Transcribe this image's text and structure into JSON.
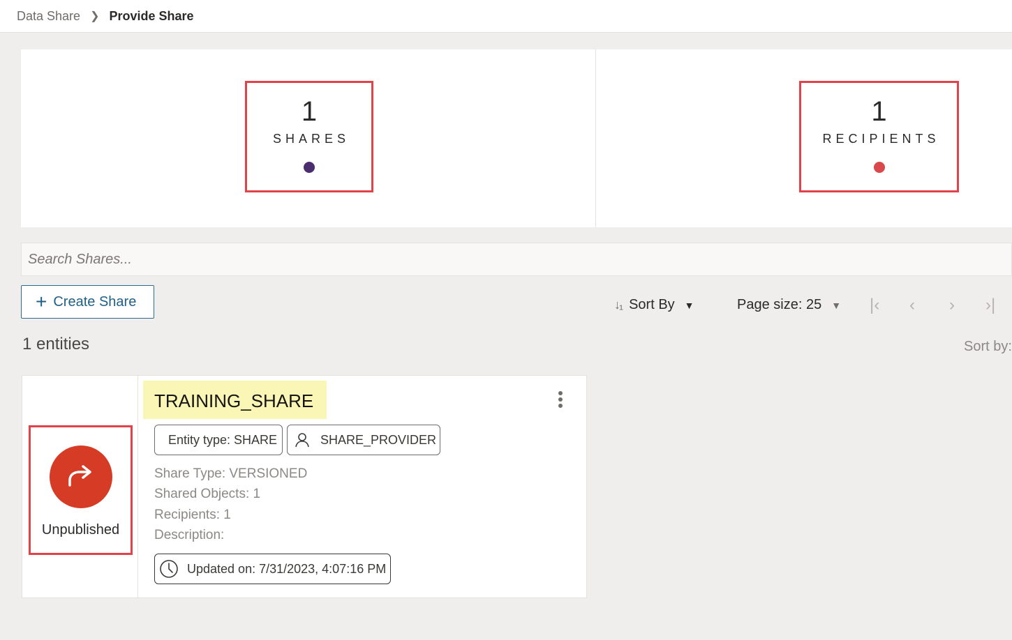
{
  "breadcrumb": {
    "parent": "Data Share",
    "current": "Provide Share"
  },
  "stats": {
    "shares": {
      "count": "1",
      "label": "SHARES",
      "dot_color": "#4b2e6f"
    },
    "recipients": {
      "count": "1",
      "label": "RECIPIENTS",
      "dot_color": "#d9484a"
    }
  },
  "search": {
    "placeholder": "Search Shares..."
  },
  "toolbar": {
    "create_label": "Create Share",
    "sort_label": "Sort By",
    "page_size_label": "Page size: 25"
  },
  "list": {
    "entities_label": "1 entities",
    "sort_by_right": "Sort by:"
  },
  "card": {
    "title": "TRAINING_SHARE",
    "status": "Unpublished",
    "entity_type": "Entity type: SHARE",
    "owner": "SHARE_PROVIDER",
    "share_type": "Share Type: VERSIONED",
    "shared_objects": "Shared Objects: 1",
    "recipients": "Recipients: 1",
    "description": "Description:",
    "updated": "Updated on: 7/31/2023, 4:07:16 PM"
  },
  "colors": {
    "accent_red": "#e2434b",
    "status_circle": "#d63b25",
    "create_button": "#1f5f86",
    "title_highlight": "#faf6b5"
  },
  "icons": {
    "breadcrumb_separator": "chevron-right-icon",
    "create": "plus-icon",
    "sort": "sort-order-icon",
    "caret": "caret-down-icon",
    "pager": [
      "first-page-icon",
      "previous-page-icon",
      "next-page-icon",
      "last-page-icon"
    ],
    "status": "share-forward-icon",
    "owner": "user-icon",
    "updated": "clock-icon",
    "menu": "kebab-menu-icon"
  }
}
